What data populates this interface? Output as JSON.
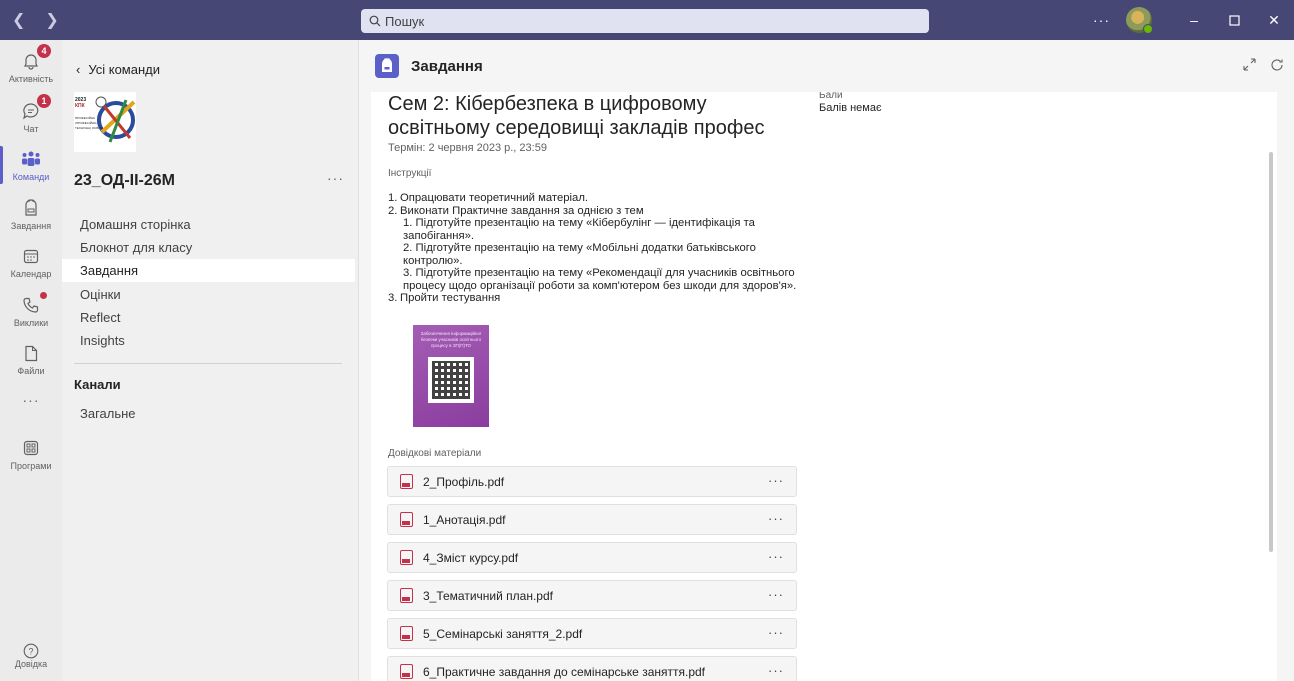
{
  "titlebar": {
    "search_placeholder": "Пошук",
    "more": "···"
  },
  "appbar": {
    "items": [
      {
        "label": "Активність",
        "badge": "4"
      },
      {
        "label": "Чат",
        "badge": "1"
      },
      {
        "label": "Команди"
      },
      {
        "label": "Завдання"
      },
      {
        "label": "Календар"
      },
      {
        "label": "Виклики"
      },
      {
        "label": "Файли"
      },
      {
        "label": "···"
      },
      {
        "label": "Програми"
      }
    ],
    "help": "Довідка"
  },
  "leftpanel": {
    "back": "Усі команди",
    "logo_text": [
      "2023",
      "КПК",
      "ПРОФЕСІЙНА",
      "(ПРОФЕСІЙНО-",
      "ТЕХНІЧНА) ОСВІТА"
    ],
    "team_name": "23_ОД-ІІ-26М",
    "more": "···",
    "nav": [
      "Домашня сторінка",
      "Блокнот для класу",
      "Завдання",
      "Оцінки",
      "Reflect",
      "Insights"
    ],
    "channels_heading": "Канали",
    "channels": [
      "Загальне"
    ]
  },
  "main": {
    "header_title": "Завдання",
    "assignment": {
      "title": "Сем 2: Кібербезпека в цифровому освітньому середовищі закладів профес",
      "due": "Термін: 2 червня 2023 р., 23:59",
      "instructions_label": "Інструкції",
      "items": [
        {
          "num": "1.",
          "text": "Опрацювати теоретичний матеріал."
        },
        {
          "num": "2.",
          "text": "Виконати Практичне завдання за однією з тем"
        },
        {
          "sub": "1. Підготуйте презентацію на тему «Кібербулінг — ідентифікація та запобігання»."
        },
        {
          "sub": "2. Підготуйте презентацію на тему «Мобільні додатки батьківського контролю»."
        },
        {
          "sub": "3. Підготуйте презентацію на тему «Рекомендації для учасників освітнього процесу щодо організації роботи за комп'ютером без шкоди для здоров'я»."
        },
        {
          "num": "3.",
          "text": "Пройти тестування"
        }
      ],
      "image_caption": "Забезпечення інформаційної безпеки учасників освітнього процесу в ЗП(П)ТО",
      "reference_label": "Довідкові матеріали",
      "files": [
        "2_Профіль.pdf",
        "1_Анотація.pdf",
        "4_Зміст курсу.pdf",
        "3_Тематичний план.pdf",
        "5_Семінарські заняття_2.pdf",
        "6_Практичне завдання до семінарське заняття.pdf"
      ],
      "file_more": "···",
      "points_label": "Бали",
      "points_value": "Балів немає"
    }
  },
  "colors": {
    "titlebar": "#464775",
    "accent": "#5b5fc7",
    "badge": "#c4314b"
  }
}
